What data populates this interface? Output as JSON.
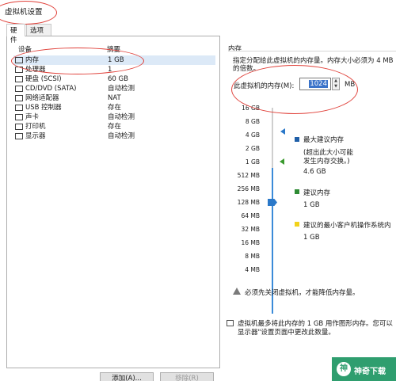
{
  "window": {
    "title": "虚拟机设置"
  },
  "tabs": [
    {
      "label": "硬件"
    },
    {
      "label": "选项"
    }
  ],
  "device_list": {
    "col_device": "设备",
    "col_summary": "摘要",
    "rows": [
      {
        "icon": "memory-icon",
        "name": "内存",
        "value": "1 GB"
      },
      {
        "icon": "cpu-icon",
        "name": "处理器",
        "value": "1"
      },
      {
        "icon": "hard-disk-icon",
        "name": "硬盘 (SCSI)",
        "value": "60 GB"
      },
      {
        "icon": "cd-dvd-icon",
        "name": "CD/DVD (SATA)",
        "value": "自动检测"
      },
      {
        "icon": "network-adapter-icon",
        "name": "网络适配器",
        "value": "NAT"
      },
      {
        "icon": "usb-icon",
        "name": "USB 控制器",
        "value": "存在"
      },
      {
        "icon": "sound-card-icon",
        "name": "声卡",
        "value": "自动检测"
      },
      {
        "icon": "printer-icon",
        "name": "打印机",
        "value": "存在"
      },
      {
        "icon": "display-icon",
        "name": "显示器",
        "value": "自动检测"
      }
    ],
    "add_label": "添加(A)...",
    "remove_label": "移除(R)"
  },
  "memory": {
    "section_title": "内存",
    "desc_line1": "指定分配给此虚拟机的内存量。内存大小必须为 4 MB",
    "desc_line2": "的倍数。",
    "field_label": "此虚拟机的内存(M):",
    "value": "1024",
    "unit": "MB",
    "scale_ticks": [
      "16 GB",
      "8 GB",
      "4 GB",
      "2 GB",
      "1 GB",
      "512 MB",
      "256 MB",
      "128 MB",
      "64 MB",
      "32 MB",
      "16 MB",
      "8 MB",
      "4 MB"
    ],
    "legend": {
      "max_title": "最大建议内存",
      "max_note1": "(超出此大小可能",
      "max_note2": "发生内存交换。)",
      "max_value": "4.6 GB",
      "rec_title": "建议内存",
      "rec_value": "1 GB",
      "min_title": "建议的最小客户机操作系统内",
      "min_value": "1 GB"
    },
    "warning": "必须先关闭虚拟机，才能降低内存量。"
  },
  "info_line1": "虚拟机最多将此内存的 1 GB 用作图形内存。您可以",
  "info_line2": "显示器\"设置页面中更改此数量。",
  "watermark": {
    "logo": "神",
    "text": "神奇下载"
  },
  "colors": {
    "selection": "#dce9f7",
    "accent_blue": "#2a78c9",
    "recommended_green": "#2e8b34",
    "min_yellow": "#f2d21a",
    "annotation_red": "#e0413a"
  }
}
